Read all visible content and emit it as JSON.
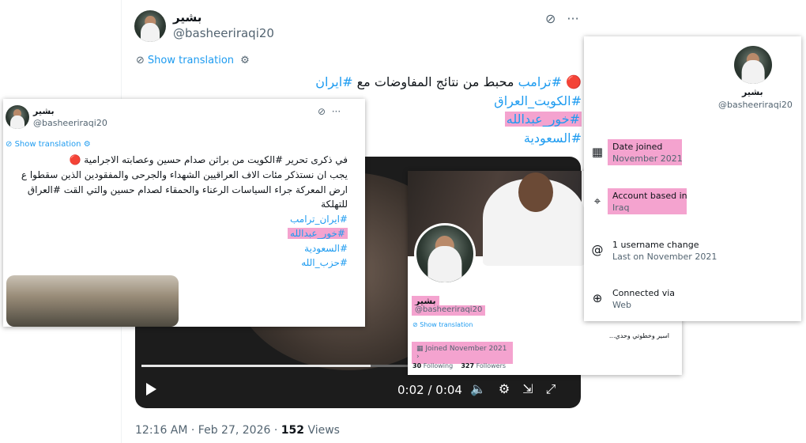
{
  "main": {
    "name": "بشير",
    "handle": "@basheeriraqi20",
    "show_translation": "Show translation",
    "text_line1_parts": [
      "🔴",
      "#ترامب",
      "محبط من نتائج المفاوضات مع",
      "#ايران"
    ],
    "hashtags": [
      "#الكويت_العراق",
      "#خور_عبدالله",
      "#السعودية"
    ],
    "video": {
      "time": "0:02 / 0:04",
      "progress": 0.53
    },
    "timestamp": "12:16 AM · Feb 27, 2026",
    "views_count": "152",
    "views_label": "Views"
  },
  "left_card": {
    "name": "بشير",
    "handle": "@basheeriraqi20",
    "show_translation": "Show translation",
    "lines": [
      "في ذكرى تحرير #الكويت من براثن صدام حسين وعصابته الاجرامية 🔴",
      "يجب ان نستذكر مئات الاف العراقيين الشهداء والجرحى والمفقودين الذين سقطوا ع",
      "ارض المعركة جراء السياسات الرعناء والحمقاء لصدام حسين  والتي القت #العراق",
      "للتهلكة"
    ],
    "hashtags": [
      "#ايران_ترامب",
      "#خور_عبدالله",
      "#السعودية",
      "#حزب_الله"
    ]
  },
  "mid_card": {
    "name": "بشير",
    "handle": "@basheeriraqi20",
    "show_translation": "Show translation",
    "joined": "Joined November 2021",
    "following_count": "30",
    "following_label": "Following",
    "followers_count": "327",
    "followers_label": "Followers",
    "bio": "اسير وخطوتي وحدي..."
  },
  "account_info": {
    "name": "بشير",
    "handle": "@basheeriraqi20",
    "rows": [
      {
        "label": "Date joined",
        "value": "November 2021"
      },
      {
        "label": "Account based in",
        "value": "Iraq"
      },
      {
        "label": "1 username change",
        "value": "Last on November 2021"
      },
      {
        "label": "Connected via",
        "value": "Web"
      }
    ]
  },
  "colors": {
    "link": "#1d9bf0",
    "highlight": "#f4a3cf",
    "muted": "#536471"
  }
}
